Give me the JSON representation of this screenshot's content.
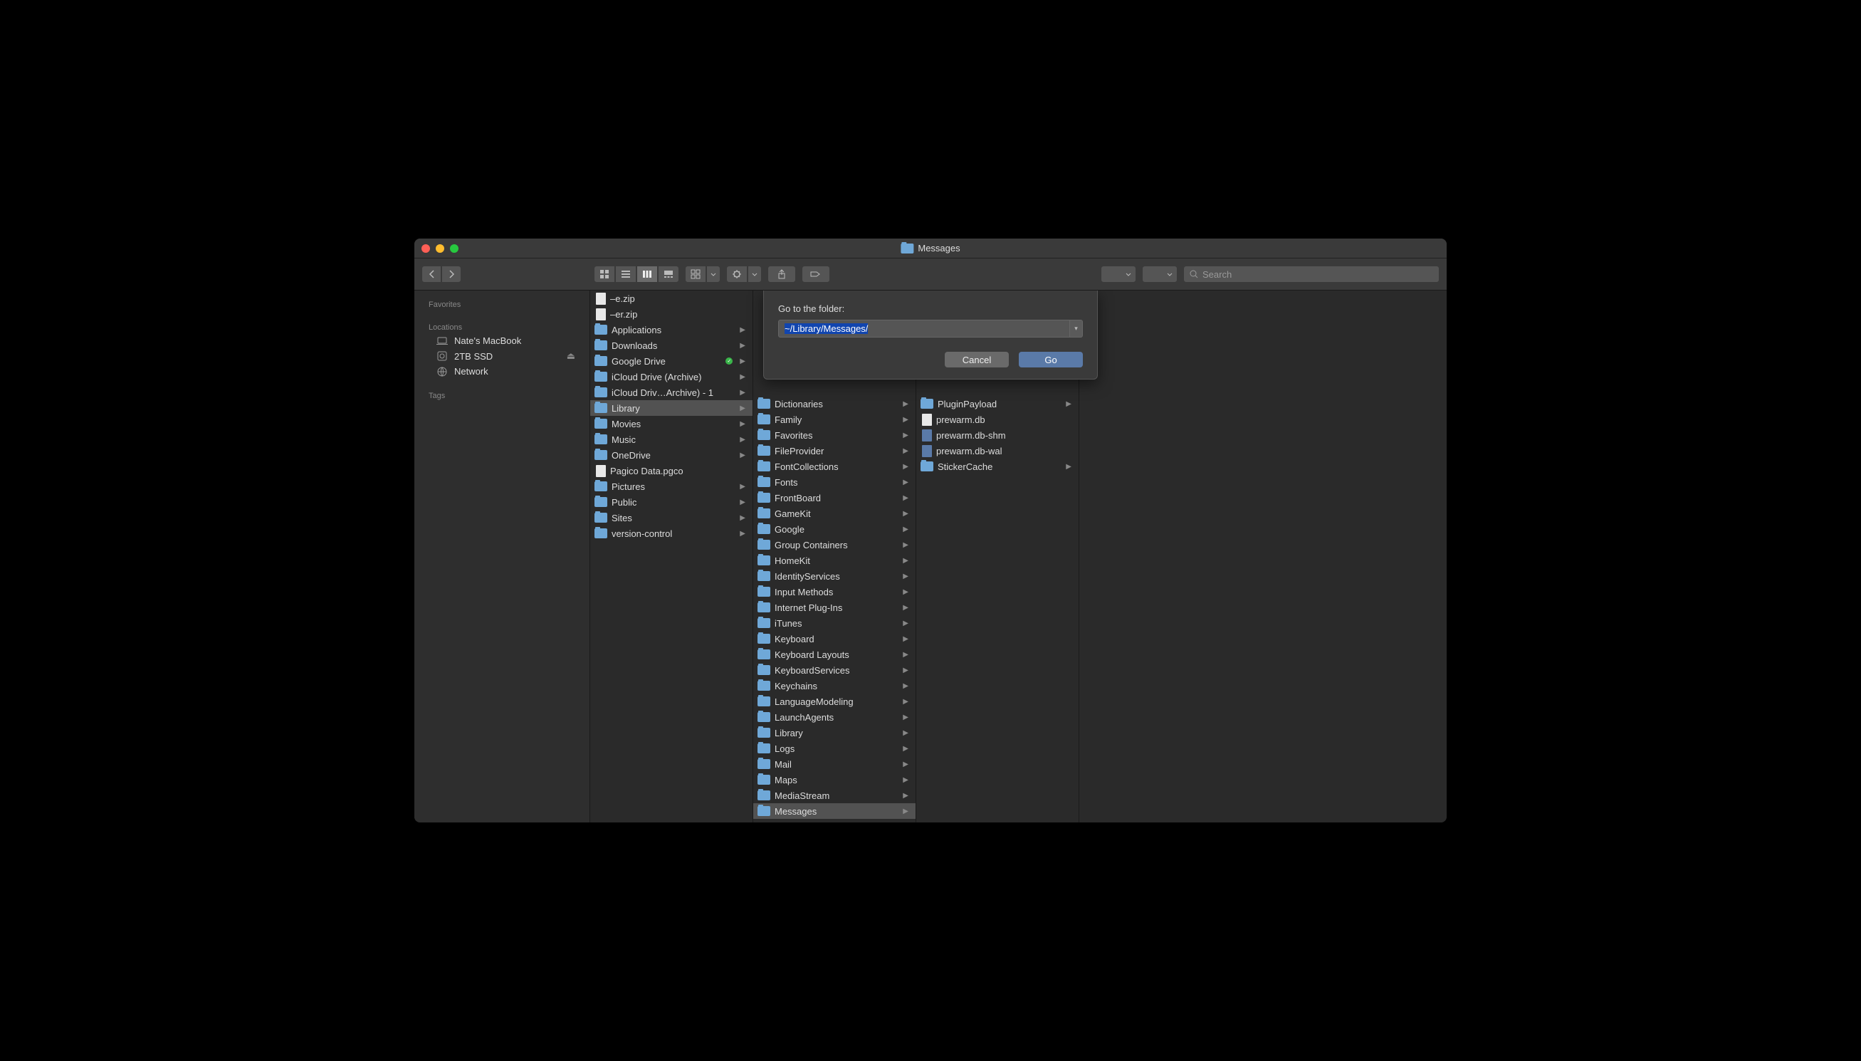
{
  "window": {
    "title": "Messages"
  },
  "toolbar": {
    "search_placeholder": "Search"
  },
  "sidebar": {
    "section_favorites": "Favorites",
    "section_locations": "Locations",
    "section_tags": "Tags",
    "locations": [
      {
        "label": "Nate's MacBook",
        "icon": "laptop"
      },
      {
        "label": "2TB SSD",
        "icon": "disk",
        "ejectable": true
      },
      {
        "label": "Network",
        "icon": "globe"
      }
    ]
  },
  "columns": [
    [
      {
        "label": "–e.zip",
        "type": "file"
      },
      {
        "label": "–er.zip",
        "type": "file"
      },
      {
        "label": "Applications",
        "type": "folder",
        "arrow": true
      },
      {
        "label": "Downloads",
        "type": "folder",
        "arrow": true
      },
      {
        "label": "Google Drive",
        "type": "folder",
        "arrow": true,
        "synced": true
      },
      {
        "label": "iCloud Drive (Archive)",
        "type": "folder",
        "arrow": true
      },
      {
        "label": "iCloud Driv…Archive) - 1",
        "type": "folder",
        "arrow": true
      },
      {
        "label": "Library",
        "type": "folder",
        "arrow": true,
        "selected": true
      },
      {
        "label": "Movies",
        "type": "folder",
        "arrow": true
      },
      {
        "label": "Music",
        "type": "folder",
        "arrow": true
      },
      {
        "label": "OneDrive",
        "type": "folder",
        "arrow": true
      },
      {
        "label": "Pagico Data.pgco",
        "type": "file"
      },
      {
        "label": "Pictures",
        "type": "folder",
        "arrow": true
      },
      {
        "label": "Public",
        "type": "folder",
        "arrow": true
      },
      {
        "label": "Sites",
        "type": "folder",
        "arrow": true
      },
      {
        "label": "version-control",
        "type": "folder",
        "arrow": true
      }
    ],
    [
      {
        "label": "Dictionaries",
        "type": "folder",
        "arrow": true
      },
      {
        "label": "Family",
        "type": "folder",
        "arrow": true
      },
      {
        "label": "Favorites",
        "type": "folder",
        "arrow": true
      },
      {
        "label": "FileProvider",
        "type": "folder",
        "arrow": true
      },
      {
        "label": "FontCollections",
        "type": "folder",
        "arrow": true
      },
      {
        "label": "Fonts",
        "type": "folder",
        "arrow": true
      },
      {
        "label": "FrontBoard",
        "type": "folder",
        "arrow": true
      },
      {
        "label": "GameKit",
        "type": "folder",
        "arrow": true
      },
      {
        "label": "Google",
        "type": "folder",
        "arrow": true
      },
      {
        "label": "Group Containers",
        "type": "folder",
        "arrow": true
      },
      {
        "label": "HomeKit",
        "type": "folder",
        "arrow": true
      },
      {
        "label": "IdentityServices",
        "type": "folder",
        "arrow": true
      },
      {
        "label": "Input Methods",
        "type": "folder",
        "arrow": true
      },
      {
        "label": "Internet Plug-Ins",
        "type": "folder",
        "arrow": true
      },
      {
        "label": "iTunes",
        "type": "folder",
        "arrow": true
      },
      {
        "label": "Keyboard",
        "type": "folder",
        "arrow": true
      },
      {
        "label": "Keyboard Layouts",
        "type": "folder",
        "arrow": true
      },
      {
        "label": "KeyboardServices",
        "type": "folder",
        "arrow": true
      },
      {
        "label": "Keychains",
        "type": "folder",
        "arrow": true
      },
      {
        "label": "LanguageModeling",
        "type": "folder",
        "arrow": true
      },
      {
        "label": "LaunchAgents",
        "type": "folder",
        "arrow": true
      },
      {
        "label": "Library",
        "type": "folder",
        "arrow": true
      },
      {
        "label": "Logs",
        "type": "folder",
        "arrow": true
      },
      {
        "label": "Mail",
        "type": "folder",
        "arrow": true
      },
      {
        "label": "Maps",
        "type": "folder",
        "arrow": true
      },
      {
        "label": "MediaStream",
        "type": "folder",
        "arrow": true
      },
      {
        "label": "Messages",
        "type": "folder",
        "arrow": true,
        "selected": true
      }
    ],
    [
      {
        "label": "PluginPayload",
        "type": "folder",
        "arrow": true
      },
      {
        "label": "prewarm.db",
        "type": "file"
      },
      {
        "label": "prewarm.db-shm",
        "type": "file-db"
      },
      {
        "label": "prewarm.db-wal",
        "type": "file-db"
      },
      {
        "label": "StickerCache",
        "type": "folder",
        "arrow": true
      }
    ]
  ],
  "modal": {
    "label": "Go to the folder:",
    "value": "~/Library/Messages/",
    "cancel": "Cancel",
    "go": "Go"
  }
}
